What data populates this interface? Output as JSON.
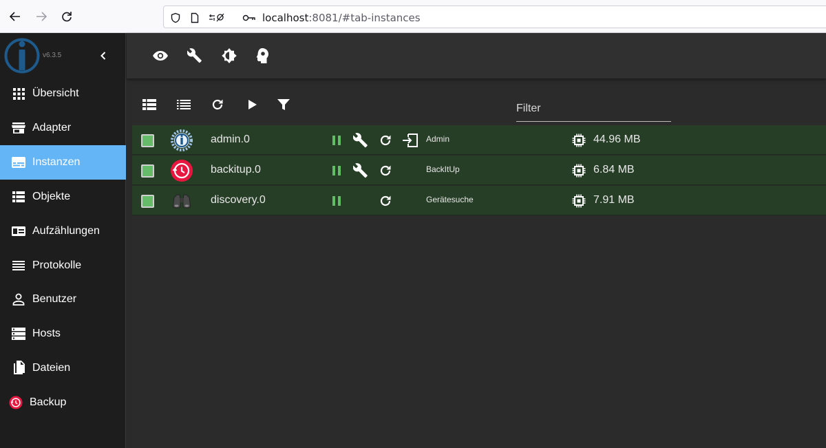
{
  "browser": {
    "url_host": "localhost",
    "url_rest": ":8081/#tab-instances"
  },
  "sidebar": {
    "version": "v6.3.5",
    "items": [
      {
        "label": "Übersicht",
        "icon": "grid-icon"
      },
      {
        "label": "Adapter",
        "icon": "store-icon"
      },
      {
        "label": "Instanzen",
        "icon": "subtitles-icon",
        "active": true
      },
      {
        "label": "Objekte",
        "icon": "list-icon"
      },
      {
        "label": "Aufzählungen",
        "icon": "enum-icon"
      },
      {
        "label": "Protokolle",
        "icon": "lines-icon"
      },
      {
        "label": "Benutzer",
        "icon": "person-icon"
      },
      {
        "label": "Hosts",
        "icon": "storage-icon"
      },
      {
        "label": "Dateien",
        "icon": "files-icon"
      },
      {
        "label": "Backup",
        "icon": "backup-icon"
      }
    ]
  },
  "toolbar": {
    "icons": [
      "eye-icon",
      "wrench-icon",
      "brightness-icon",
      "head-icon"
    ]
  },
  "panel": {
    "filter_label": "Filter",
    "icons": [
      "view-list-icon",
      "list-icon",
      "refresh-icon",
      "play-icon",
      "filter-icon"
    ]
  },
  "instances": [
    {
      "name": "admin.0",
      "title": "Admin",
      "memory": "44.96 MB",
      "has_config": true,
      "has_link": true
    },
    {
      "name": "backitup.0",
      "title": "BackItUp",
      "memory": "6.84 MB",
      "has_config": true,
      "has_link": false
    },
    {
      "name": "discovery.0",
      "title": "Gerätesuche",
      "memory": "7.91 MB",
      "has_config": false,
      "has_link": false
    }
  ],
  "colors": {
    "accent": "#64b5f6",
    "row_bg": "#263e26",
    "running": "#66bb6a",
    "sidebar_bg": "#1d1d1d"
  }
}
